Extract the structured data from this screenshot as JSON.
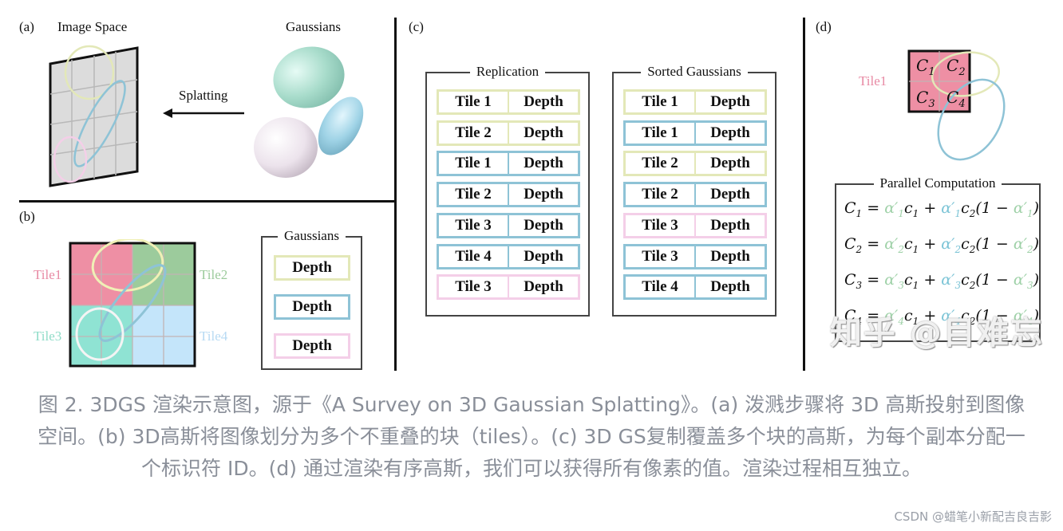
{
  "colors": {
    "yellow": "#e3e8b8",
    "blue": "#8ec3d6",
    "pink": "#f4cfe8",
    "tile1": "#ee8fa4",
    "tile2": "#9ccb9c",
    "tile3": "#8fe3d3",
    "tile4": "#c4e5fa",
    "green_alpha": "#9fd1a8",
    "blue_alpha": "#7cc4d6"
  },
  "panel_a": {
    "label": "(a)",
    "image_space_title": "Image Space",
    "gaussians_title": "Gaussians",
    "arrow_label": "Splatting"
  },
  "panel_b": {
    "label": "(b)",
    "tiles": [
      "Tile1",
      "Tile2",
      "Tile3",
      "Tile4"
    ],
    "gaussians_box_title": "Gaussians",
    "depth_items": [
      "Depth",
      "Depth",
      "Depth"
    ]
  },
  "panel_c": {
    "label": "(c)",
    "replication": {
      "title": "Replication",
      "rows": [
        {
          "tile": "Tile 1",
          "value": "Depth",
          "color": "yellow"
        },
        {
          "tile": "Tile 2",
          "value": "Depth",
          "color": "yellow"
        },
        {
          "tile": "Tile 1",
          "value": "Depth",
          "color": "blue"
        },
        {
          "tile": "Tile 2",
          "value": "Depth",
          "color": "blue"
        },
        {
          "tile": "Tile 3",
          "value": "Depth",
          "color": "blue"
        },
        {
          "tile": "Tile 4",
          "value": "Depth",
          "color": "blue"
        },
        {
          "tile": "Tile 3",
          "value": "Depth",
          "color": "pink"
        }
      ]
    },
    "sorted": {
      "title": "Sorted Gaussians",
      "rows": [
        {
          "tile": "Tile 1",
          "value": "Depth",
          "color": "yellow"
        },
        {
          "tile": "Tile 1",
          "value": "Depth",
          "color": "blue"
        },
        {
          "tile": "Tile 2",
          "value": "Depth",
          "color": "yellow"
        },
        {
          "tile": "Tile 2",
          "value": "Depth",
          "color": "blue"
        },
        {
          "tile": "Tile 3",
          "value": "Depth",
          "color": "pink"
        },
        {
          "tile": "Tile 3",
          "value": "Depth",
          "color": "blue"
        },
        {
          "tile": "Tile 4",
          "value": "Depth",
          "color": "blue"
        }
      ]
    }
  },
  "panel_d": {
    "label": "(d)",
    "tile_label": "Tile1",
    "pixels": [
      "C1",
      "C2",
      "C3",
      "C4"
    ],
    "parallel_title": "Parallel Computation",
    "equations": [
      {
        "lhs": "C",
        "idx": "1"
      },
      {
        "lhs": "C",
        "idx": "2"
      },
      {
        "lhs": "C",
        "idx": "3"
      },
      {
        "lhs": "C",
        "idx": "4"
      }
    ]
  },
  "watermark_zhihu": "知乎 @目难忘",
  "caption": "图 2. 3DGS 渲染示意图，源于《A Survey on 3D Gaussian Splatting》。(a) 泼溅步骤将 3D 高斯投射到图像空间。(b) 3D高斯将图像划分为多个不重叠的块（tiles）。(c) 3D GS复制覆盖多个块的高斯，为每个副本分配一个标识符 ID。(d) 通过渲染有序高斯，我们可以获得所有像素的值。渲染过程相互独立。",
  "watermark_csdn": "CSDN @蜡笔小新配吉良吉影"
}
